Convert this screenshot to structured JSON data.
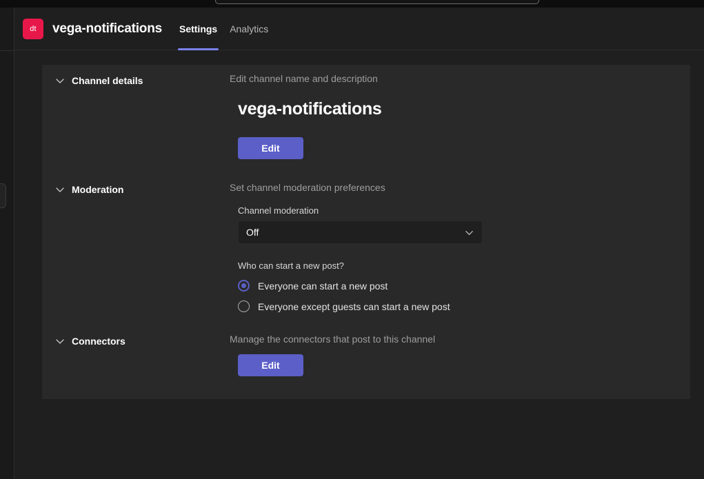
{
  "window": {
    "background_color": "#1f1f1f",
    "card_color": "#292929",
    "accent_color": "#5b5fc7",
    "tab_underline_color": "#7b83eb",
    "avatar_color": "#e8174a"
  },
  "header": {
    "avatar_initials": "dt",
    "channel_title": "vega-notifications",
    "tabs": [
      {
        "label": "Settings",
        "active": true
      },
      {
        "label": "Analytics",
        "active": false
      }
    ]
  },
  "sections": {
    "channel_details": {
      "title": "Channel details",
      "description": "Edit channel name and description",
      "channel_name": "vega-notifications",
      "edit_label": "Edit"
    },
    "moderation": {
      "title": "Moderation",
      "description": "Set channel moderation preferences",
      "channel_moderation_label": "Channel moderation",
      "channel_moderation_value": "Off",
      "who_can_post_label": "Who can start a new post?",
      "options": [
        {
          "label": "Everyone can start a new post",
          "selected": true
        },
        {
          "label": "Everyone except guests can start a new post",
          "selected": false
        }
      ]
    },
    "connectors": {
      "title": "Connectors",
      "description": "Manage the connectors that post to this channel",
      "edit_label": "Edit"
    }
  }
}
